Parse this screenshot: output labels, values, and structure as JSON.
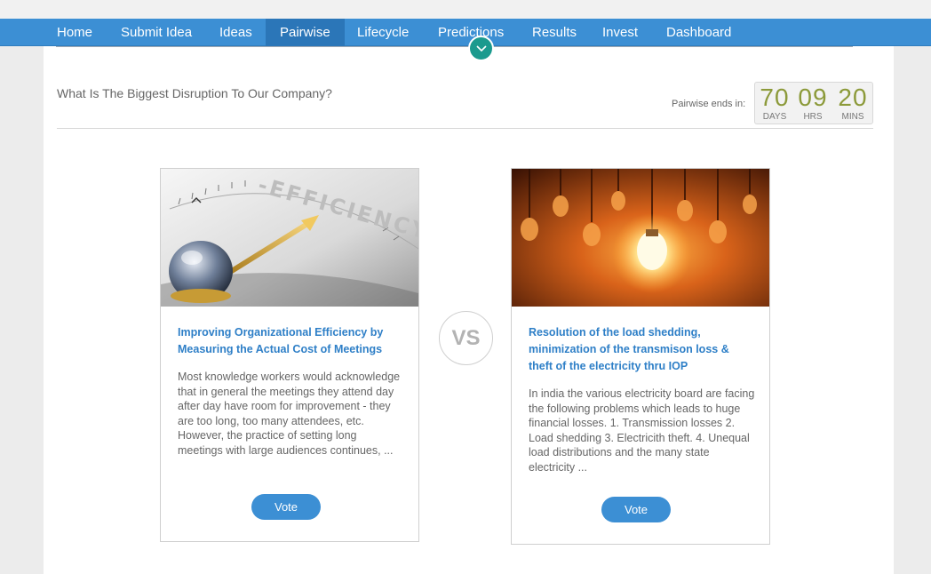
{
  "nav": {
    "items": [
      {
        "label": "Home"
      },
      {
        "label": "Submit Idea"
      },
      {
        "label": "Ideas"
      },
      {
        "label": "Pairwise",
        "active": true
      },
      {
        "label": "Lifecycle"
      },
      {
        "label": "Predictions"
      },
      {
        "label": "Results"
      },
      {
        "label": "Invest"
      },
      {
        "label": "Dashboard"
      }
    ]
  },
  "toggle_icon": "chevron-down-icon",
  "question": "What Is The Biggest Disruption To Our Company?",
  "countdown": {
    "label": "Pairwise ends in:",
    "days": "70",
    "days_label": "DAYS",
    "hrs": "09",
    "hrs_label": "HRS",
    "mins": "20",
    "mins_label": "MINS"
  },
  "vs_label": "VS",
  "ideas": [
    {
      "image": "efficiency-compass-image",
      "title": "Improving Organizational Efficiency by Measuring the Actual Cost of Meetings",
      "description": "Most knowledge workers would acknowledge that in general the meetings they attend day after day have room for improvement - they are too long, too many attendees, etc. However, the practice of setting long meetings with large audiences continues, ...",
      "vote_label": "Vote"
    },
    {
      "image": "light-bulbs-image",
      "title": "Resolution of the load shedding, minimization of the transmison loss & theft of the electricity thru IOP",
      "description": "In india the various electricity board are facing the following problems which leads to huge financial losses. 1. Transmission losses 2. Load shedding 3. Electricith theft. 4. Unequal load distributions and the many state electricity ...",
      "vote_label": "Vote"
    }
  ],
  "colors": {
    "nav_bg": "#3c8fd4",
    "nav_active": "#2b76b8",
    "toggle": "#1b9a8e",
    "title_link": "#2e7fc7",
    "countdown_digits": "#8c9a3a"
  }
}
